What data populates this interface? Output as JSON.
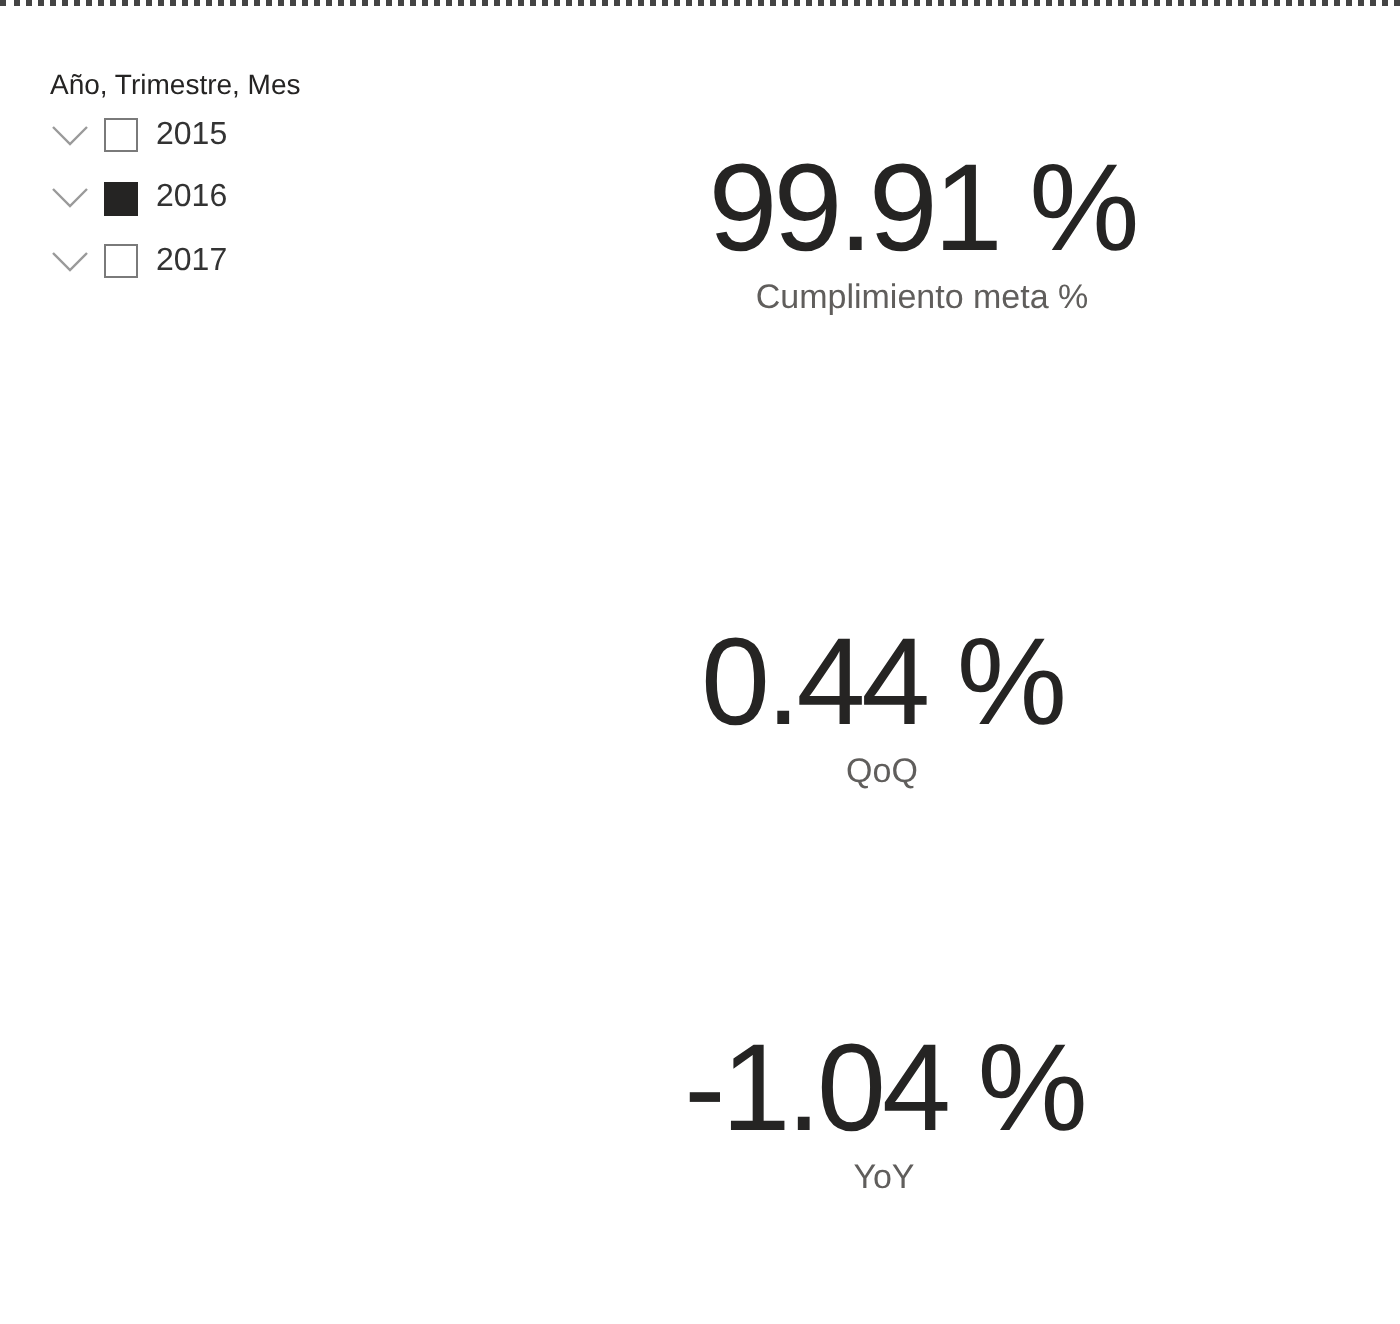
{
  "slicer": {
    "title": "Año, Trimestre, Mes",
    "items": [
      {
        "label": "2015",
        "checked": false
      },
      {
        "label": "2016",
        "checked": true
      },
      {
        "label": "2017",
        "checked": false
      }
    ]
  },
  "cards": [
    {
      "value": "99.91 %",
      "label": "Cumplimiento meta %"
    },
    {
      "value": "0.44 %",
      "label": "QoQ"
    },
    {
      "value": "-1.04 %",
      "label": "YoY"
    }
  ]
}
